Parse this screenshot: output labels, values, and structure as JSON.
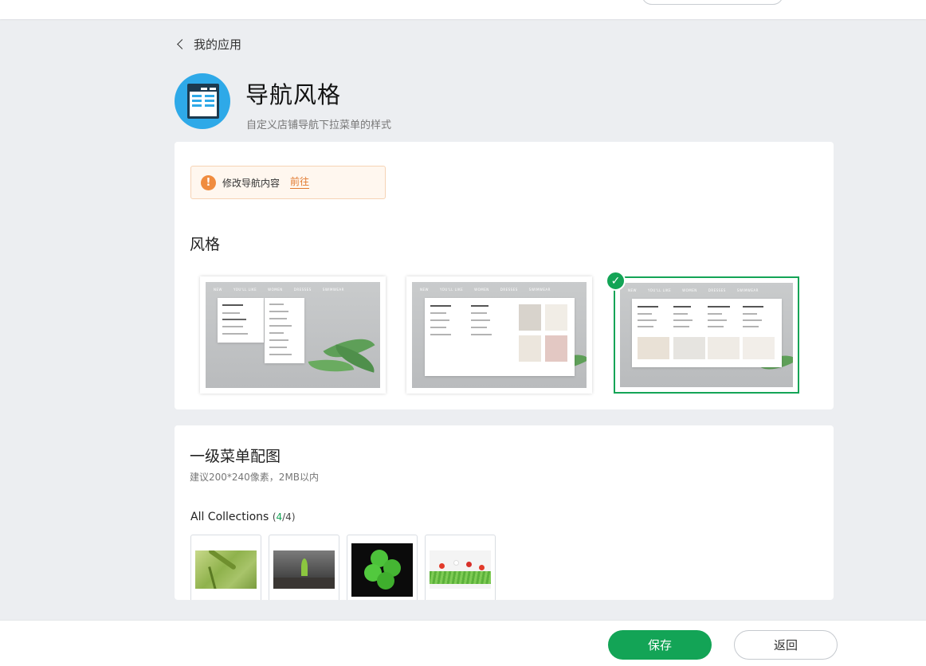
{
  "header": {
    "back_label": "我的应用",
    "title": "导航风格",
    "subtitle": "自定义店铺导航下拉菜单的样式"
  },
  "notice": {
    "icon": "exclamation-icon",
    "text": "修改导航内容",
    "link": "前往"
  },
  "style_section": {
    "title": "风格",
    "options": [
      {
        "id": "dropdown-list",
        "selected": false,
        "nav": [
          "NEW",
          "YOU'LL LIKE",
          "WOMEN",
          "DRESSES",
          "SWIMWEAR"
        ]
      },
      {
        "id": "mega-menu-images",
        "selected": false,
        "nav": [
          "NEW",
          "YOU'LL LIKE",
          "WOMEN",
          "DRESSES",
          "SWIMWEAR"
        ]
      },
      {
        "id": "mega-menu-columns",
        "selected": true,
        "nav": [
          "NEW",
          "YOU'LL LIKE",
          "WOMEN",
          "DRESSES",
          "SWIMWEAR"
        ]
      }
    ]
  },
  "menu_section": {
    "title": "一级菜单配图",
    "hint": "建议200*240像素，2MB以内",
    "collection_label": "All Collections",
    "count_current": "4",
    "count_total": "/4",
    "images": [
      "grass-image",
      "sprout-image",
      "clover-image",
      "flowers-image"
    ]
  },
  "footer": {
    "save_label": "保存",
    "back_label": "返回"
  },
  "colors": {
    "accent": "#13a456",
    "warning": "#f08c3f",
    "app_icon": "#2ea9e8"
  }
}
